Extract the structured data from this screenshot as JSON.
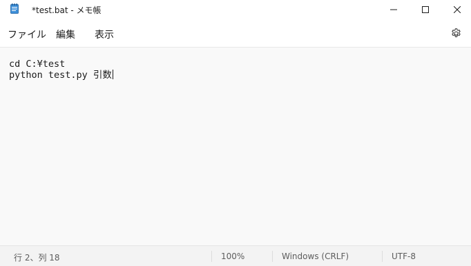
{
  "window": {
    "title": "*test.bat - メモ帳",
    "app_icon": "notepad-icon",
    "controls": {
      "minimize_icon": "minimize-icon",
      "maximize_icon": "maximize-icon",
      "close_icon": "close-icon"
    }
  },
  "menubar": {
    "items": [
      {
        "label": "ファイル"
      },
      {
        "label": "編集"
      },
      {
        "label": "表示"
      }
    ],
    "settings_icon": "gear-icon"
  },
  "editor": {
    "lines": [
      "cd C:¥test",
      "python test.py 引数"
    ]
  },
  "statusbar": {
    "cursor_position": "行 2、列 18",
    "zoom": "100%",
    "line_ending": "Windows (CRLF)",
    "encoding": "UTF-8"
  }
}
